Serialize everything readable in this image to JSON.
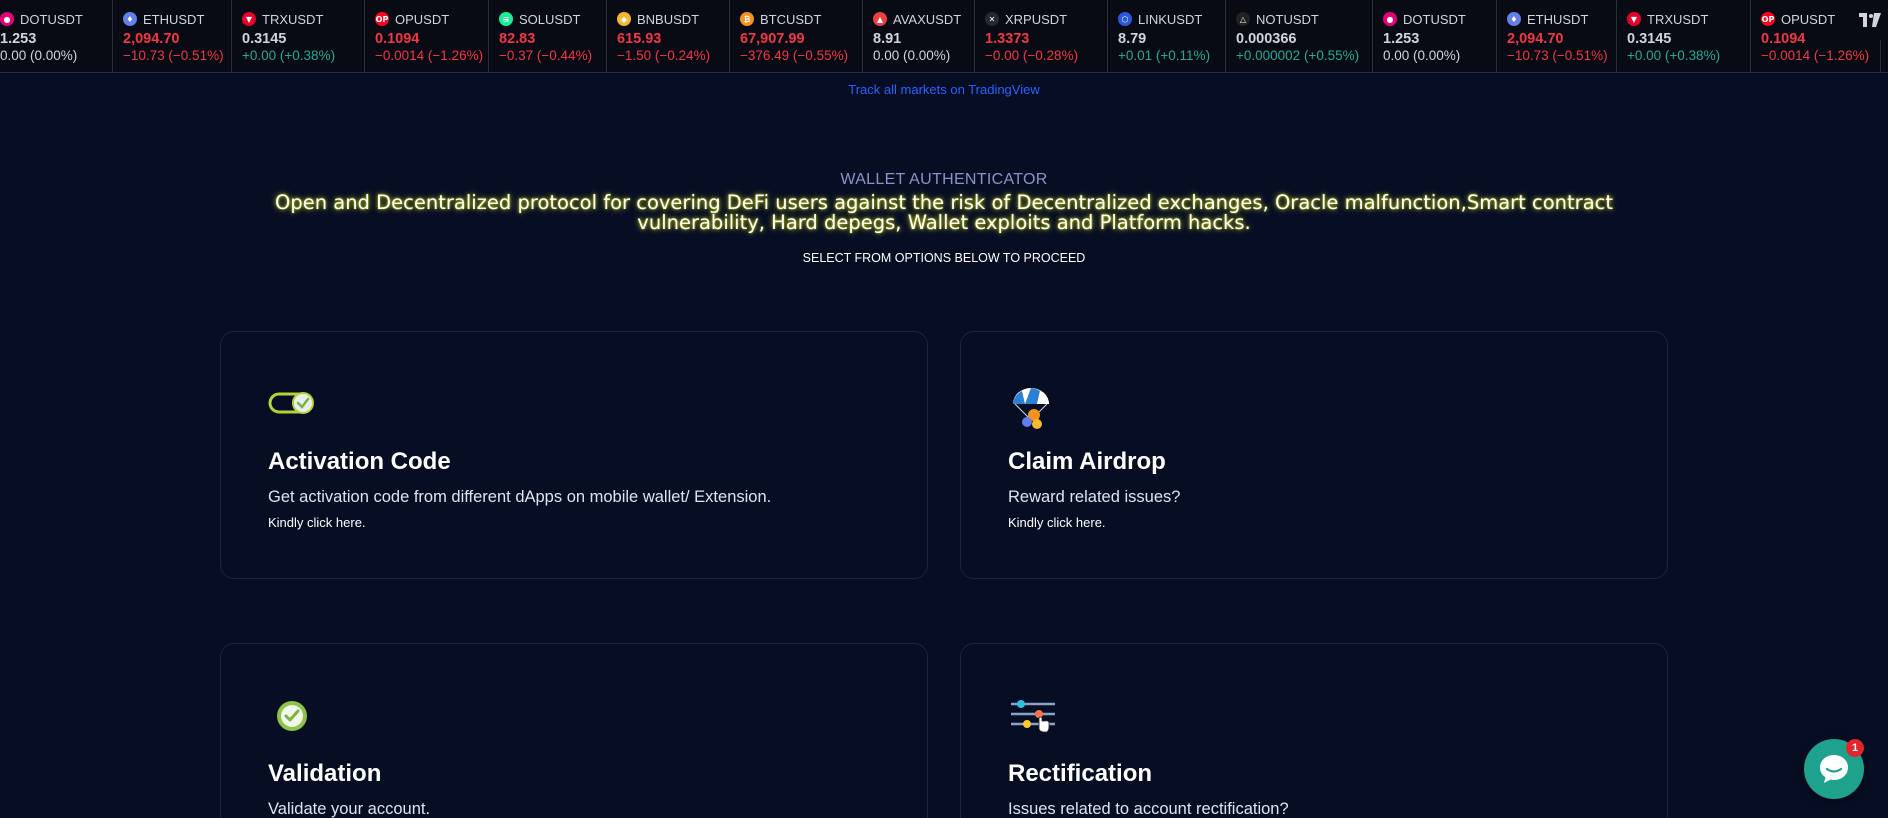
{
  "ticker": {
    "items": [
      {
        "symbol": "DOTUSDT",
        "price": "1.253",
        "change": "0.00 (0.00%)",
        "dir": "flat",
        "color": "#e6007a",
        "glyph": "●",
        "width": 123
      },
      {
        "symbol": "ETHUSDT",
        "price": "2,094.70",
        "change": "−10.73 (−0.51%)",
        "dir": "down",
        "color": "#627eea",
        "glyph": "♦",
        "width": 119
      },
      {
        "symbol": "TRXUSDT",
        "price": "0.3145",
        "change": "+0.00 (+0.38%)",
        "dir": "up",
        "color": "#eb0029",
        "glyph": "▼",
        "width": 133
      },
      {
        "symbol": "OPUSDT",
        "price": "0.1094",
        "change": "−0.0014 (−1.26%)",
        "dir": "down",
        "color": "#ff0420",
        "glyph": "OP",
        "width": 124
      },
      {
        "symbol": "SOLUSDT",
        "price": "82.83",
        "change": "−0.37 (−0.44%)",
        "dir": "down",
        "color": "#14f195",
        "glyph": "≡",
        "width": 118
      },
      {
        "symbol": "BNBUSDT",
        "price": "615.93",
        "change": "−1.50 (−0.24%)",
        "dir": "down",
        "color": "#f3ba2f",
        "glyph": "◆",
        "width": 123
      },
      {
        "symbol": "BTCUSDT",
        "price": "67,907.99",
        "change": "−376.49 (−0.55%)",
        "dir": "down",
        "color": "#f7931a",
        "glyph": "₿",
        "width": 133
      },
      {
        "symbol": "AVAXUSDT",
        "price": "8.91",
        "change": "0.00 (0.00%)",
        "dir": "flat",
        "color": "#e84142",
        "glyph": "▲",
        "width": 112
      },
      {
        "symbol": "XRPUSDT",
        "price": "1.3373",
        "change": "−0.00 (−0.28%)",
        "dir": "down",
        "color": "#23292f",
        "glyph": "✕",
        "width": 133
      },
      {
        "symbol": "LINKUSDT",
        "price": "8.79",
        "change": "+0.01 (+0.11%)",
        "dir": "up",
        "color": "#2a5ada",
        "glyph": "⬡",
        "width": 118
      },
      {
        "symbol": "NOTUSDT",
        "price": "0.000366",
        "change": "+0.000002 (+0.55%)",
        "dir": "up",
        "color": "#222222",
        "glyph": "△",
        "width": 147
      },
      {
        "symbol": "DOTUSDT",
        "price": "1.253",
        "change": "0.00 (0.00%)",
        "dir": "flat",
        "color": "#e6007a",
        "glyph": "●",
        "width": 124
      },
      {
        "symbol": "ETHUSDT",
        "price": "2,094.70",
        "change": "−10.73 (−0.51%)",
        "dir": "down",
        "color": "#627eea",
        "glyph": "♦",
        "width": 120
      },
      {
        "symbol": "TRXUSDT",
        "price": "0.3145",
        "change": "+0.00 (+0.38%)",
        "dir": "up",
        "color": "#eb0029",
        "glyph": "▼",
        "width": 134
      },
      {
        "symbol": "OPUSDT",
        "price": "0.1094",
        "change": "−0.0014 (−1.26%)",
        "dir": "down",
        "color": "#ff0420",
        "glyph": "OP",
        "width": 130
      }
    ],
    "link_text": "Track all markets on TradingView"
  },
  "hero": {
    "eyebrow": "WALLET AUTHENTICATOR",
    "headline": "Open and Decentralized protocol for covering DeFi users against the risk of Decentralized exchanges, Oracle malfunction,Smart contract vulnerability, Hard depegs, Wallet exploits and Platform hacks.",
    "select_note": "SELECT FROM OPTIONS BELOW TO PROCEED"
  },
  "cards": [
    {
      "title": "Activation Code",
      "desc": "Get activation code from different dApps on mobile wallet/ Extension.",
      "link": "Kindly click here.",
      "icon": "toggle-check-icon"
    },
    {
      "title": "Claim Airdrop",
      "desc": "Reward related issues?",
      "link": "Kindly click here.",
      "icon": "airdrop-parachute-icon"
    },
    {
      "title": "Validation",
      "desc": "Validate your account.",
      "link": "",
      "icon": "check-circle-icon"
    },
    {
      "title": "Rectification",
      "desc": "Issues related to account rectification?",
      "link": "",
      "icon": "sliders-hand-icon"
    }
  ],
  "chat": {
    "badge": "1"
  },
  "colors": {
    "background": "#070e24",
    "accent_link": "#2962ff",
    "chat": "#1ea28e",
    "up": "#22ab94",
    "down": "#f23645"
  }
}
